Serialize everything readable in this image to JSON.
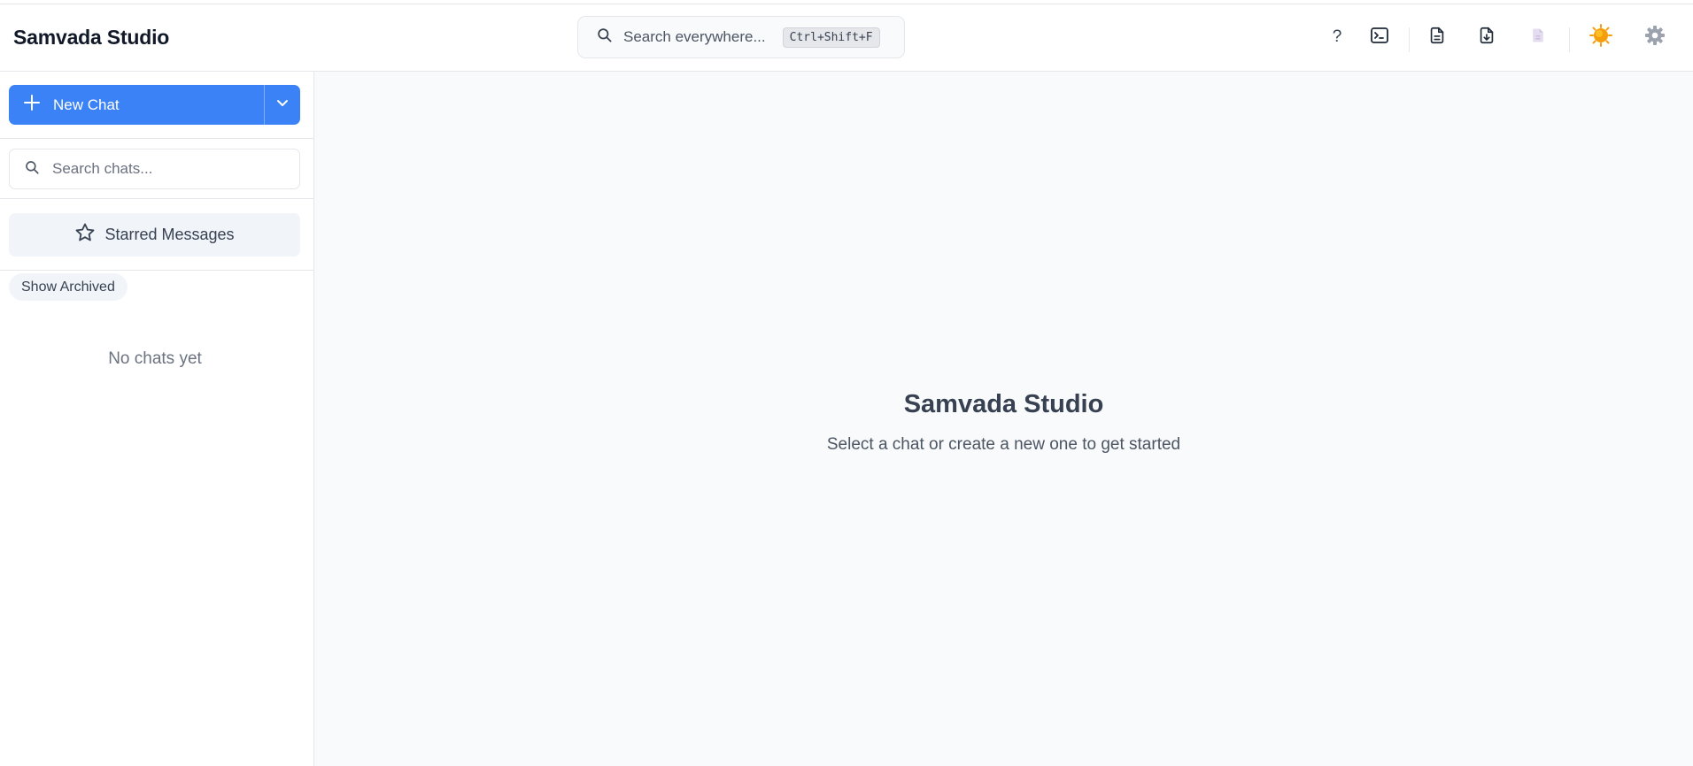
{
  "header": {
    "title": "Samvada Studio",
    "search_text": "Search everywhere...",
    "search_shortcut": "Ctrl+Shift+F",
    "help_glyph": "?",
    "icons": [
      "help-icon",
      "terminal-icon",
      "document-icon",
      "document-download-icon",
      "document-disabled-icon",
      "sun-theme-icon",
      "gear-icon"
    ]
  },
  "sidebar": {
    "new_chat_label": "New Chat",
    "search_placeholder": "Search chats...",
    "starred_label": "Starred Messages",
    "archived_label": "Show Archived",
    "empty_text": "No chats yet"
  },
  "main": {
    "title": "Samvada Studio",
    "subtitle": "Select a chat or create a new one to get started"
  },
  "colors": {
    "accent": "#3b82f6",
    "sun": "#f59e0b",
    "gear": "#9ca3af",
    "disabled_doc": "#d8cfe6"
  }
}
